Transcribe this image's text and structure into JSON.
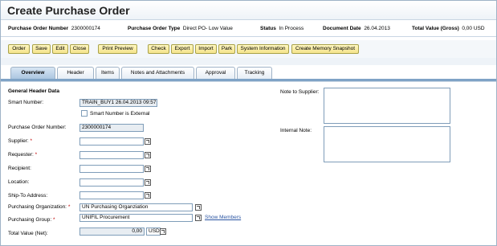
{
  "title": "Create Purchase Order",
  "info": {
    "po_number_label": "Purchase Order Number",
    "po_number_value": "2300000174",
    "po_type_label": "Purchase Order Type",
    "po_type_value": "Direct PO- Low Value",
    "status_label": "Status",
    "status_value": "In Process",
    "doc_date_label": "Document Date",
    "doc_date_value": "26.04.2013",
    "total_label": "Total Value (Gross)",
    "total_value": "0,00 USD"
  },
  "toolbar": {
    "order": "Order",
    "save": "Save",
    "edit": "Edit",
    "close": "Close",
    "print_preview": "Print Preview",
    "check": "Check",
    "export": "Export",
    "import": "Import",
    "park": "Park",
    "system_information": "System Information",
    "create_memory_snapshot": "Create Memory Snapshot"
  },
  "tabs": [
    "Overview",
    "Header",
    "Items",
    "Notes and Attachments",
    "Approval",
    "Tracking"
  ],
  "section_title": "General Header Data",
  "form": {
    "smart_number_label": "Smart Number:",
    "smart_number_value": "TRAIN_BUY1 26.04.2013 09:57",
    "smart_number_external_label": "Smart Number is External",
    "po_number_label": "Purchase Order Number:",
    "po_number_value": "2300000174",
    "supplier_label": "Supplier:",
    "requester_label": "Requester:",
    "recipient_label": "Recipient:",
    "location_label": "Location:",
    "ship_to_label": "Ship-To Address:",
    "purch_org_label": "Purchasing Organization:",
    "purch_org_value": "UN Purchasing Organziation",
    "purch_group_label": "Purchasing Group:",
    "purch_group_value": "UNIFIL Procurement",
    "show_members": "Show Members",
    "total_net_label": "Total Value (Net):",
    "total_net_value": "0,00",
    "currency_value": "USD",
    "required_marker": "*"
  },
  "notes": {
    "note_to_supplier_label": "Note to Supplier:",
    "internal_note_label": "Internal Note:"
  },
  "colors": {
    "accent": "#7fa3c6",
    "button_fill": "#f4e38a",
    "required": "#c00000",
    "link": "#2c56a3"
  }
}
